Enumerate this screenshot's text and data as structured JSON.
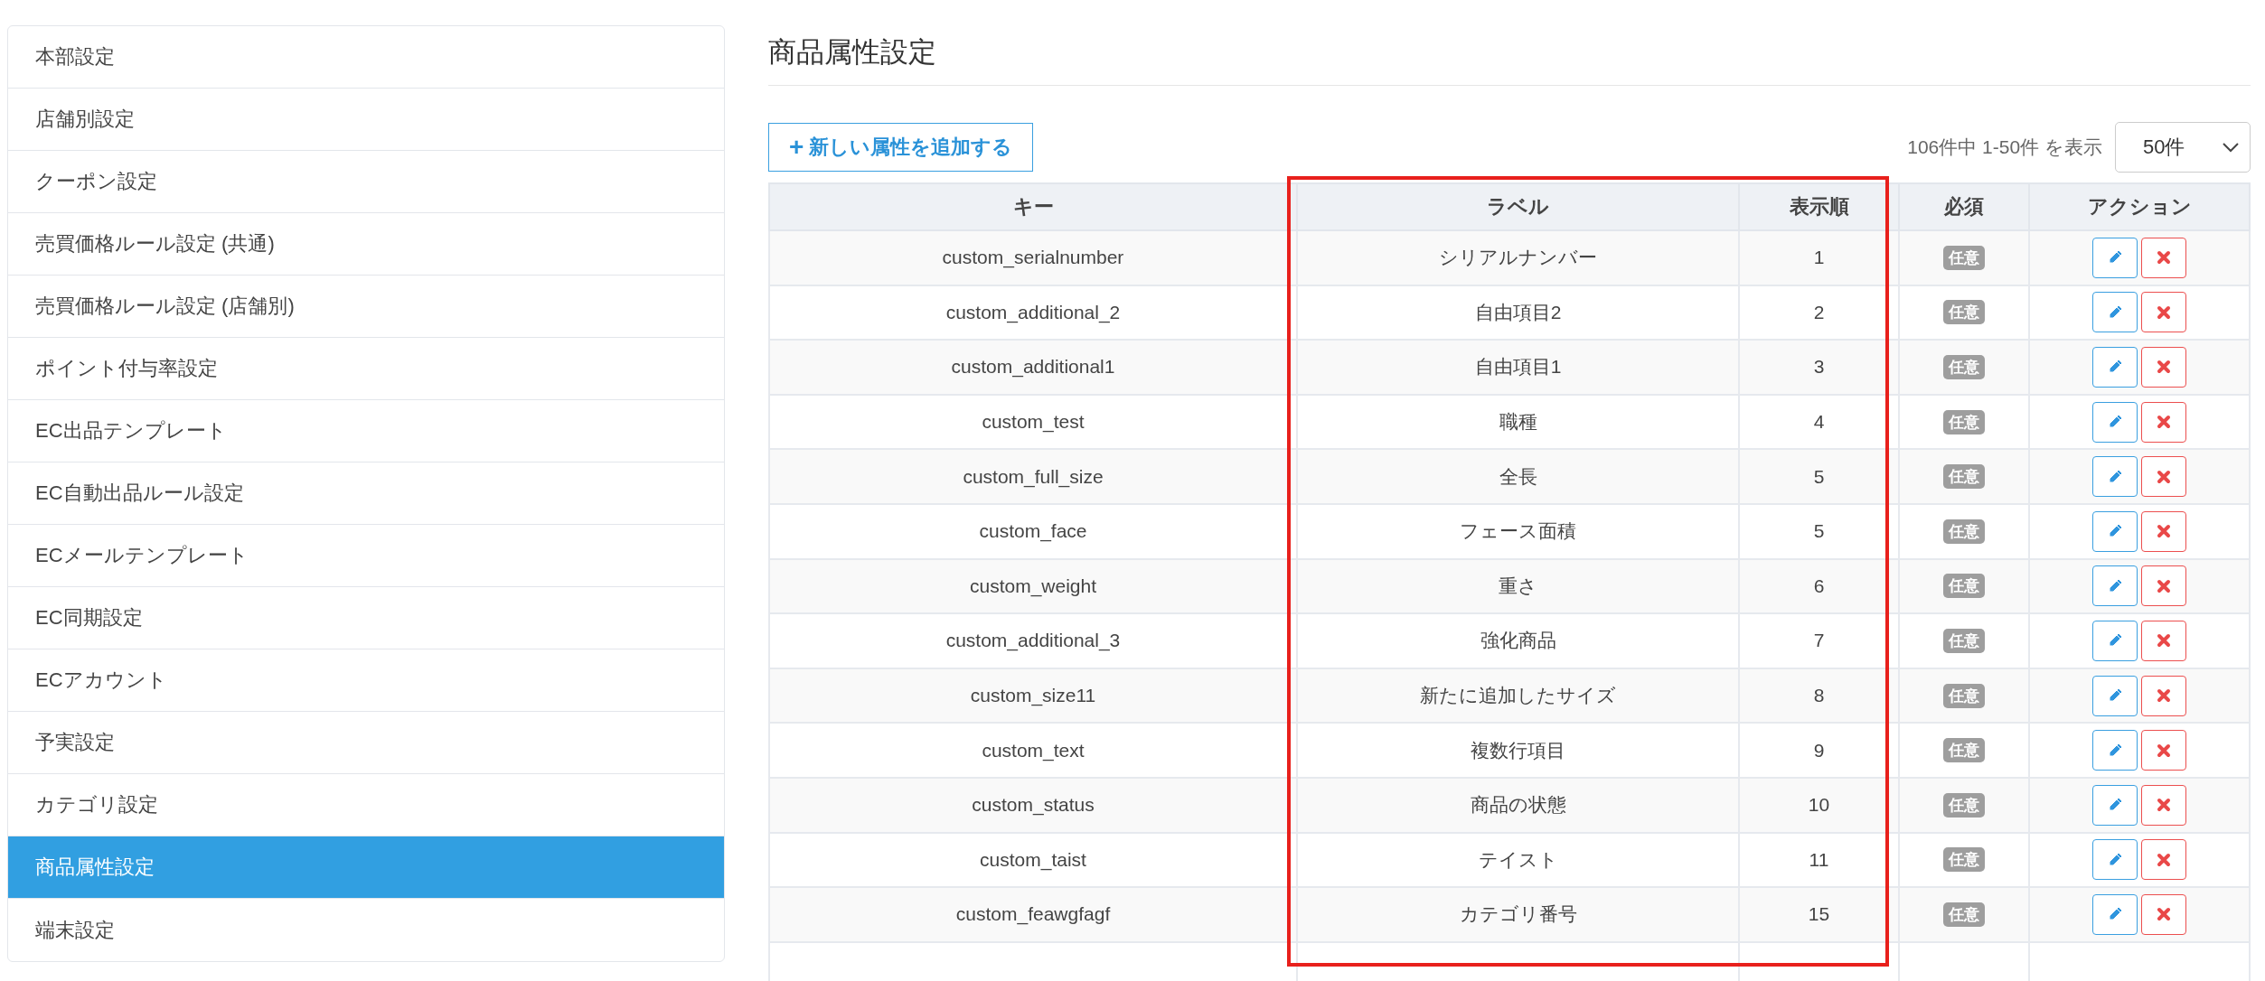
{
  "sidebar": {
    "items": [
      {
        "label": "本部設定",
        "selected": false
      },
      {
        "label": "店舗別設定",
        "selected": false
      },
      {
        "label": "クーポン設定",
        "selected": false
      },
      {
        "label": "売買価格ルール設定 (共通)",
        "selected": false
      },
      {
        "label": "売買価格ルール設定 (店舗別)",
        "selected": false
      },
      {
        "label": "ポイント付与率設定",
        "selected": false
      },
      {
        "label": "EC出品テンプレート",
        "selected": false
      },
      {
        "label": "EC自動出品ルール設定",
        "selected": false
      },
      {
        "label": "ECメールテンプレート",
        "selected": false
      },
      {
        "label": "EC同期設定",
        "selected": false
      },
      {
        "label": "ECアカウント",
        "selected": false
      },
      {
        "label": "予実設定",
        "selected": false
      },
      {
        "label": "カテゴリ設定",
        "selected": false
      },
      {
        "label": "商品属性設定",
        "selected": true
      },
      {
        "label": "端末設定",
        "selected": false
      }
    ]
  },
  "page_title": "商品属性設定",
  "add_button": {
    "icon": "+",
    "label": "新しい属性を追加する"
  },
  "pagination": {
    "summary": "106件中 1-50件 を表示",
    "page_size": "50件"
  },
  "table": {
    "columns": [
      "キー",
      "ラベル",
      "表示順",
      "必須",
      "アクション"
    ],
    "rows": [
      {
        "key": "custom_serialnumber",
        "label": "シリアルナンバー",
        "order": "1",
        "required": "任意"
      },
      {
        "key": "custom_additional_2",
        "label": "自由項目2",
        "order": "2",
        "required": "任意"
      },
      {
        "key": "custom_additional1",
        "label": "自由項目1",
        "order": "3",
        "required": "任意"
      },
      {
        "key": "custom_test",
        "label": "職種",
        "order": "4",
        "required": "任意"
      },
      {
        "key": "custom_full_size",
        "label": "全長",
        "order": "5",
        "required": "任意"
      },
      {
        "key": "custom_face",
        "label": "フェース面積",
        "order": "5",
        "required": "任意"
      },
      {
        "key": "custom_weight",
        "label": "重さ",
        "order": "6",
        "required": "任意"
      },
      {
        "key": "custom_additional_3",
        "label": "強化商品",
        "order": "7",
        "required": "任意"
      },
      {
        "key": "custom_size11",
        "label": "新たに追加したサイズ",
        "order": "8",
        "required": "任意"
      },
      {
        "key": "custom_text",
        "label": "複数行項目",
        "order": "9",
        "required": "任意"
      },
      {
        "key": "custom_status",
        "label": "商品の状態",
        "order": "10",
        "required": "任意"
      },
      {
        "key": "custom_taist",
        "label": "テイスト",
        "order": "11",
        "required": "任意"
      },
      {
        "key": "custom_feawgfagf",
        "label": "カテゴリ番号",
        "order": "15",
        "required": "任意"
      }
    ]
  }
}
